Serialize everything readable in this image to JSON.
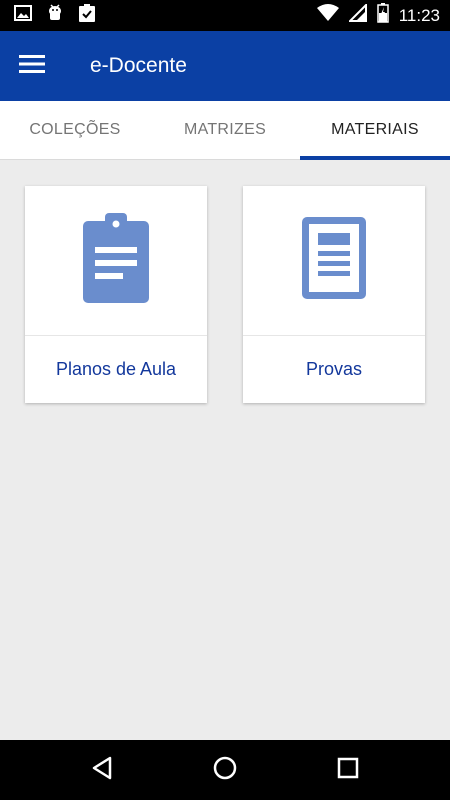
{
  "status_bar": {
    "time": "11:23",
    "icons": [
      "image-icon",
      "android-debug-icon",
      "clipboard-check-icon",
      "wifi-icon",
      "signal-icon",
      "battery-icon"
    ]
  },
  "app_bar": {
    "title": "e-Docente",
    "menu_icon": "hamburger-menu-icon",
    "color": "#0b40a4"
  },
  "tabs": [
    {
      "label": "COLEÇÕES",
      "active": false
    },
    {
      "label": "MATRIZES",
      "active": false
    },
    {
      "label": "MATERIAIS",
      "active": true
    }
  ],
  "cards": [
    {
      "label": "Planos de Aula",
      "icon": "clipboard-icon"
    },
    {
      "label": "Provas",
      "icon": "document-icon"
    }
  ],
  "nav_bar": {
    "icons": [
      "back-icon",
      "home-icon",
      "recents-icon"
    ]
  },
  "colors": {
    "accent": "#0b40a4",
    "icon_blue": "#6a8dcd",
    "card_label": "#13389c"
  }
}
